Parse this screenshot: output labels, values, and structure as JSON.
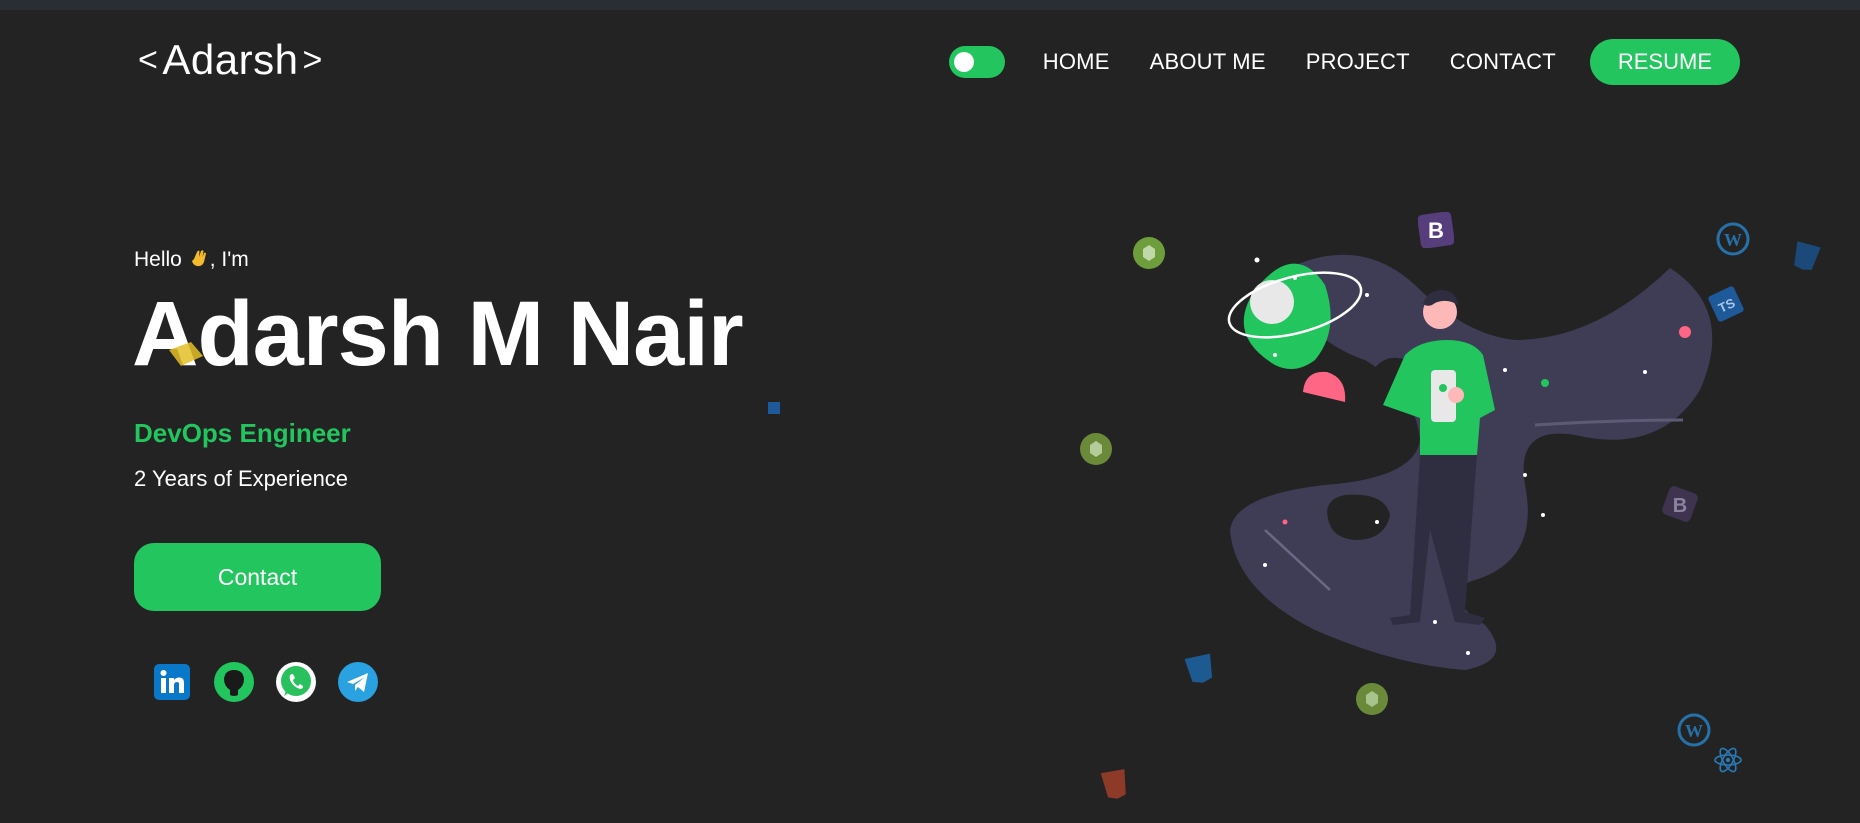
{
  "brand": {
    "logo_open": "<",
    "logo_text": "Adarsh",
    "logo_close": ">"
  },
  "nav": {
    "theme_toggle_on": true,
    "links": [
      "HOME",
      "ABOUT ME",
      "PROJECT",
      "CONTACT"
    ],
    "resume_label": "RESUME"
  },
  "hero": {
    "greeting_pre": "Hello",
    "greeting_post": ", I'm",
    "name": "Adarsh M Nair",
    "role": "DevOps Engineer",
    "experience": "2 Years of Experience",
    "contact_label": "Contact"
  },
  "socials": [
    {
      "icon": "linkedin-icon"
    },
    {
      "icon": "github-icon"
    },
    {
      "icon": "whatsapp-icon"
    },
    {
      "icon": "telegram-icon"
    }
  ],
  "floating_icons": [
    "node-icon",
    "bootstrap-icon",
    "wordpress-icon",
    "html5-icon",
    "typescript-icon",
    "sass-icon",
    "react-icon"
  ],
  "colors": {
    "background": "#232323",
    "accent": "#22c55e",
    "text": "#ffffff",
    "path": "#3f3d56"
  }
}
